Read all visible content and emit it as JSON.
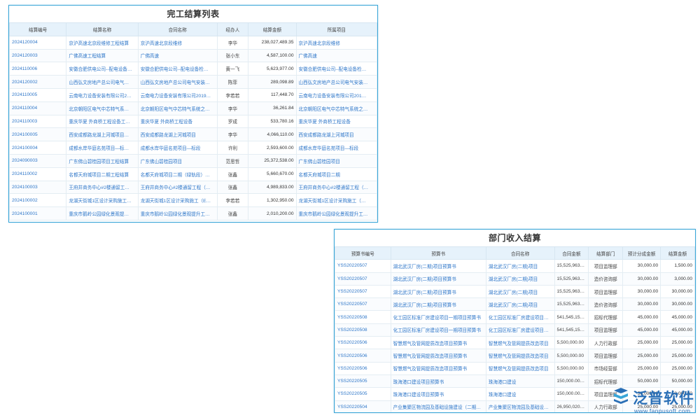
{
  "panel1": {
    "title": "完工结算列表",
    "headers": [
      "结算编号",
      "结算名称",
      "合同名称",
      "经办人",
      "结算金额",
      "所属项目"
    ],
    "rows": [
      [
        "2024120004",
        "京沪高速北京段维修工程结算",
        "京沪高速北京段维修",
        "李华",
        "238,027,489.35",
        "京沪高速北京段维修"
      ],
      [
        "2024120003",
        "广佛高速工程结算",
        "广佛高速",
        "张小东",
        "4,587,100.00",
        "广佛高速"
      ],
      [
        "2024110006",
        "安徽合肥供电公司--配电设备…",
        "安徽合肥供电公司--配电设备检…",
        "黄一飞",
        "5,623,977.00",
        "安徽合肥供电公司--配电设备检…"
      ],
      [
        "2024120002",
        "山西弘文房地产总公司电气…",
        "山西弘文房地产总公司电气安装…",
        "陈菲",
        "289,098.89",
        "山西弘文房地产总公司电气安装…"
      ],
      [
        "2024110005",
        "云南电力设备安装有限公司2…",
        "云南电力设备安装有限公司2019…",
        "李若若",
        "117,448.70",
        "云南电力设备安装有限公司201…"
      ],
      [
        "2024110004",
        "北京朝阳区电气中芯特气系…",
        "北京朝阳区电气中芯特气系统之…",
        "李华",
        "36,261.84",
        "北京朝阳区电气中芯特气系统之…"
      ],
      [
        "2024110003",
        "重庆华夏 外商桥工程设备工…",
        "重庆华夏 外商桥工程设备",
        "罗成",
        "533,780.16",
        "重庆华夏 外商桥工程设备"
      ],
      [
        "2024100005",
        "西安成都路龙湖上河城项目…",
        "西安成都路龙湖上河城项目",
        "李华",
        "4,066,110.00",
        "西安成都路龙湖上河城项目"
      ],
      [
        "2024100004",
        "成都水岸华庭名苑项目—标…",
        "成都水岸华庭名苑项目—标段",
        "许利",
        "2,593,600.00",
        "成都水岸华庭名苑项目—标段"
      ],
      [
        "2024090003",
        "广东佛山碧桂园项目工程结算",
        "广东佛山碧桂园项目",
        "范思哲",
        "25,372,538.00",
        "广东佛山碧桂园项目"
      ],
      [
        "2024110002",
        "名都天府城项目二期工程结算",
        "名都天府城项目二期（绿轨段）…",
        "张鑫",
        "5,660,670.00",
        "名都天府城项目二期"
      ],
      [
        "2024100003",
        "王府井商务中心#2楼通留工…",
        "王府井商务中心#2楼通留工程（…",
        "张鑫",
        "4,989,833.00",
        "王府井商务中心#2楼通留工程（…"
      ],
      [
        "2024100002",
        "龙湖天街城1区设计采购施工…",
        "龙湖天街城1区设计采购施工（E…",
        "李若若",
        "1,302,950.00",
        "龙湖天街城1区设计采购施工（…"
      ],
      [
        "2024100001",
        "重庆市鹅岭公园绿化景观提…",
        "重庆市鹅岭公园绿化景观提升工…",
        "张鑫",
        "2,010,200.00",
        "重庆市鹅岭公园绿化景观提升工…"
      ]
    ]
  },
  "panel2": {
    "title": "部门收入结算",
    "headers": [
      "预算书编号",
      "预算书",
      "合同名称",
      "合同金额",
      "结算部门",
      "预计分成金额",
      "结算金额"
    ],
    "rows": [
      [
        "YSS20220507",
        "湖北武汉厂房(二期)项目预算书",
        "湖北武汉厂房(二期)项目",
        "15,525,963…",
        "项目监理部",
        "30,000.00",
        "1,500.00"
      ],
      [
        "YSS20220507",
        "湖北武汉厂房(二期)项目预算书",
        "湖北武汉厂房(二期)项目",
        "15,525,963…",
        "造价咨询部",
        "30,000.00",
        "3,000.00"
      ],
      [
        "YSS20220507",
        "湖北武汉厂房(二期)项目预算书",
        "湖北武汉厂房(二期)项目",
        "15,525,963…",
        "项目监理部",
        "30,000.00",
        "30,000.00"
      ],
      [
        "YSS20220507",
        "湖北武汉厂房(二期)项目预算书",
        "湖北武汉厂房(二期)项目",
        "15,525,963…",
        "造价咨询部",
        "30,000.00",
        "30,000.00"
      ],
      [
        "YSS20220508",
        "化工园区标准厂房建设项目一期项目预算书",
        "化工园区标准厂房建设项目一期…",
        "541,545,15…",
        "招标代理部",
        "45,000.00",
        "45,000.00"
      ],
      [
        "YSS20220508",
        "化工园区标准厂房建设项目一期项目预算书",
        "化工园区标准厂房建设项目一期…",
        "541,545,15…",
        "项目监理部",
        "45,000.00",
        "45,000.00"
      ],
      [
        "YSS20220506",
        "智慧燃气及管网提质改造项目预算书",
        "智慧燃气及管网提质改造项目",
        "5,500,000.00",
        "人力行政部",
        "25,000.00",
        "25,000.00"
      ],
      [
        "YSS20220506",
        "智慧燃气及管网提质改造项目预算书",
        "智慧燃气及管网提质改造项目",
        "5,500,000.00",
        "项目监理部",
        "25,000.00",
        "25,000.00"
      ],
      [
        "YSS20220506",
        "智慧燃气及管网提质改造项目预算书",
        "智慧燃气及管网提质改造项目",
        "5,500,000.00",
        "市场经营部",
        "25,000.00",
        "25,000.00"
      ],
      [
        "YSS20220505",
        "珠海港口建设项目预算书",
        "珠海港口建设",
        "150,000.00…",
        "招标代理部",
        "50,000.00",
        "50,000.00"
      ],
      [
        "YSS20220505",
        "珠海港口建设项目预算书",
        "珠海港口建设",
        "150,000.00…",
        "项目监理部",
        "50,000.00",
        "50,000.00"
      ],
      [
        "YSS20220504",
        "产业集聚区物流园及基础设施建设（二期…",
        "产业集聚区物流园及基础设…",
        "26,950,020…",
        "人力行政部",
        "25,000.00",
        "25,000.00"
      ]
    ]
  },
  "watermark": {
    "brand": "泛普软件",
    "url": "www.fanpusoft.com"
  },
  "colors": {
    "accent": "#3aa6d8",
    "link": "#2f77c9",
    "header_bg": "#e6f2fb",
    "brand": "#2a6fb6"
  }
}
